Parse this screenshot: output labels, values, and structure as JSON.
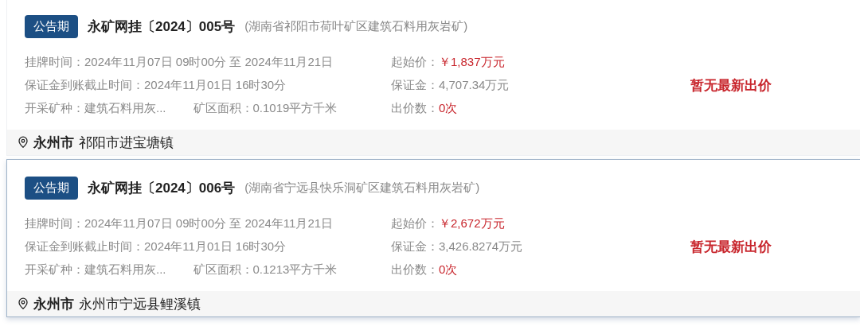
{
  "listings": [
    {
      "selected": false,
      "status": "公告期",
      "title": "永矿网挂〔2024〕005号",
      "subtitle": "(湖南省祁阳市荷叶矿区建筑石料用灰岩矿)",
      "rows": [
        [
          {
            "label": "挂牌时间：",
            "value": "2024年11月07日 09时00分 至 2024年11月21日"
          }
        ],
        [
          {
            "label": "保证金到账截止时间：",
            "value": "2024年11月01日 16时30分"
          }
        ],
        [
          {
            "label": "开采矿种：",
            "value": "建筑石料用灰..."
          },
          {
            "label": "矿区面积：",
            "value": "0.1019平方千米"
          }
        ]
      ],
      "prices": [
        {
          "label": "起始价：",
          "value": "￥1,837万元",
          "highlight": true
        },
        {
          "label": "保证金：",
          "value": "4,707.34万元",
          "highlight": false
        },
        {
          "label": "出价数：",
          "value": "0次",
          "highlight": true
        }
      ],
      "bid_status": "暂无最新出价",
      "city": "永州市",
      "address": "祁阳市进宝塘镇"
    },
    {
      "selected": true,
      "status": "公告期",
      "title": "永矿网挂〔2024〕006号",
      "subtitle": "(湖南省宁远县快乐洞矿区建筑石料用灰岩矿)",
      "rows": [
        [
          {
            "label": "挂牌时间：",
            "value": "2024年11月07日 09时00分 至 2024年11月21日"
          }
        ],
        [
          {
            "label": "保证金到账截止时间：",
            "value": "2024年11月01日 16时30分"
          }
        ],
        [
          {
            "label": "开采矿种：",
            "value": "建筑石料用灰..."
          },
          {
            "label": "矿区面积：",
            "value": "0.1213平方千米"
          }
        ]
      ],
      "prices": [
        {
          "label": "起始价：",
          "value": "￥2,672万元",
          "highlight": true
        },
        {
          "label": "保证金：",
          "value": "3,426.8274万元",
          "highlight": false
        },
        {
          "label": "出价数：",
          "value": "0次",
          "highlight": true
        }
      ],
      "bid_status": "暂无最新出价",
      "city": "永州市",
      "address": "永州市宁远县鲤溪镇"
    }
  ]
}
